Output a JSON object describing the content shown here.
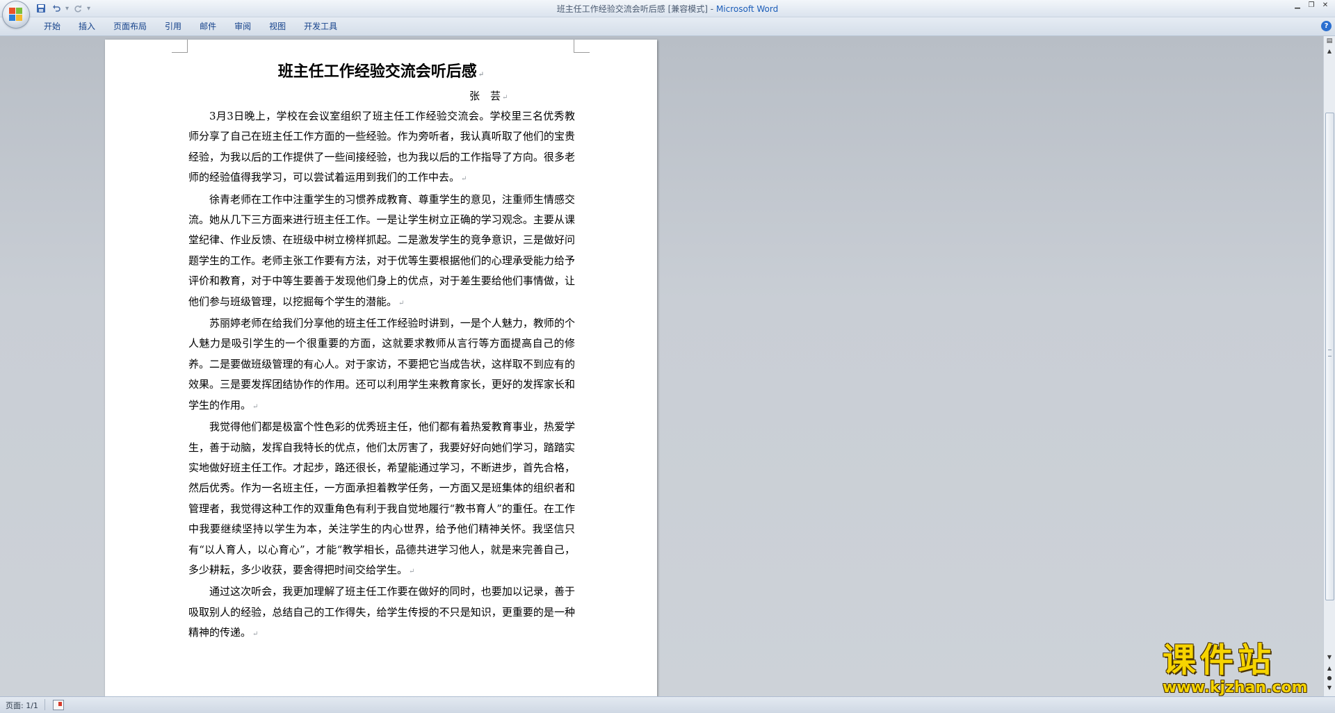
{
  "window": {
    "doc_title": "班主任工作经验交流会听后感 [兼容模式]",
    "separator": " - ",
    "app_name": "Microsoft Word"
  },
  "ribbon": {
    "tabs": [
      "开始",
      "插入",
      "页面布局",
      "引用",
      "邮件",
      "审阅",
      "视图",
      "开发工具"
    ],
    "help_label": "?"
  },
  "document": {
    "title": "班主任工作经验交流会听后感",
    "author": "张　芸",
    "paragraph_mark": "↵",
    "paragraphs": [
      "3月3日晚上，学校在会议室组织了班主任工作经验交流会。学校里三名优秀教师分享了自己在班主任工作方面的一些经验。作为旁听者，我认真听取了他们的宝贵经验，为我以后的工作提供了一些间接经验，也为我以后的工作指导了方向。很多老师的经验值得我学习，可以尝试着运用到我们的工作中去。",
      "徐青老师在工作中注重学生的习惯养成教育、尊重学生的意见，注重师生情感交流。她从几下三方面来进行班主任工作。一是让学生树立正确的学习观念。主要从课堂纪律、作业反馈、在班级中树立榜样抓起。二是激发学生的竞争意识，三是做好问题学生的工作。老师主张工作要有方法，对于优等生要根据他们的心理承受能力给予评价和教育，对于中等生要善于发现他们身上的优点，对于差生要给他们事情做，让他们参与班级管理，以挖掘每个学生的潜能。",
      "苏丽婷老师在给我们分享他的班主任工作经验时讲到，一是个人魅力，教师的个人魅力是吸引学生的一个很重要的方面，这就要求教师从言行等方面提高自己的修养。二是要做班级管理的有心人。对于家访，不要把它当成告状，这样取不到应有的效果。三是要发挥团结协作的作用。还可以利用学生来教育家长，更好的发挥家长和学生的作用。",
      "我觉得他们都是极富个性色彩的优秀班主任，他们都有着热爱教育事业，热爱学生，善于动脑，发挥自我特长的优点，他们太厉害了，我要好好向她们学习，踏踏实实地做好班主任工作。才起步，路还很长，希望能通过学习，不断进步，首先合格，然后优秀。作为一名班主任，一方面承担着教学任务，一方面又是班集体的组织者和管理者，我觉得这种工作的双重角色有利于我自觉地履行“教书育人”的重任。在工作中我要继续坚持以学生为本，关注学生的内心世界，给予他们精神关怀。我坚信只有“以人育人，以心育心”，才能“教学相长，品德共进学习他人，就是来完善自己，多少耕耘，多少收获，要舍得把时间交给学生。",
      "通过这次听会，我更加理解了班主任工作要在做好的同时，也要加以记录，善于吸取别人的经验，总结自己的工作得失，给学生传授的不只是知识，更重要的是一种精神的传递。"
    ]
  },
  "statusbar": {
    "page_info": "页面: 1/1"
  },
  "watermark": {
    "text": "课件站",
    "url": "www.kjzhan.com"
  },
  "colors": {
    "ribbon_tab_text": "#15428b",
    "app_name": "#1a5cb8",
    "workspace_bg": "#c2c7ce",
    "watermark": "#f6d400"
  },
  "icons": {
    "office_button": "office-logo-icon",
    "save": "save-icon",
    "undo": "undo-icon",
    "redo": "redo-icon",
    "customize": "customize-qat-icon",
    "help": "help-icon",
    "proofing": "proofing-icon"
  }
}
